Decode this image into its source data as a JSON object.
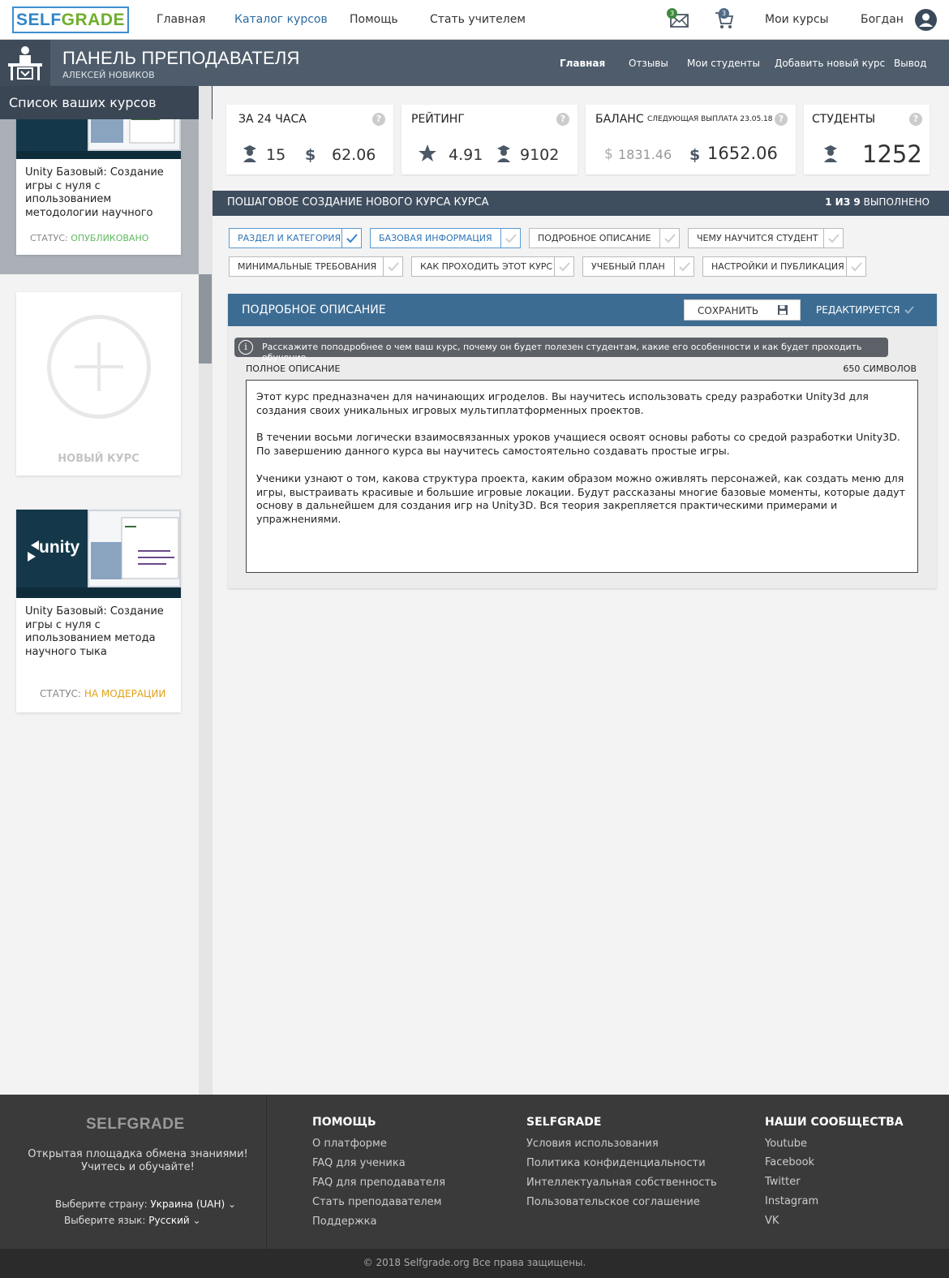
{
  "brand": {
    "part1": "SELF",
    "part2": "GRADE"
  },
  "nav": {
    "items": [
      "Главная",
      "Каталог курсов",
      "Помощь",
      "Стать учителем"
    ],
    "messages_count": "3",
    "cart_count": "3",
    "my_courses": "Мои курсы",
    "user_name": "Богдан"
  },
  "panel": {
    "title": "ПАНЕЛЬ ПРЕПОДАВАТЕЛЯ",
    "teacher_name": "АЛЕКСЕЙ НОВИКОВ",
    "links": [
      "Главная",
      "Отзывы",
      "Мои студенты",
      "Добавить новый курс",
      "Вывод"
    ]
  },
  "sidebar": {
    "title": "Список ваших курсов",
    "courses": [
      {
        "title": "Unity Базовый: Создание игры с нуля с ипользованием методологии научного",
        "status_label": "СТАТУС:",
        "status_value": "ОПУБЛИКОВАНО"
      },
      {
        "title": "Unity Базовый: Создание игры с нуля с ипользованием метода научного тыка",
        "status_label": "СТАТУС:",
        "status_value": "НА МОДЕРАЦИИ"
      }
    ],
    "new_course": "НОВЫЙ КУРС",
    "unity_logo_text": "unity"
  },
  "stats": {
    "day": {
      "title": "ЗА 24 ЧАСА",
      "students": "15",
      "earnings": "62.06"
    },
    "rating": {
      "title": "РЕЙТИНГ",
      "rating": "4.91",
      "reviews": "9102"
    },
    "balance": {
      "title": "БАЛАНС",
      "next_payout": "СЛЕДУЮЩАЯ ВЫПЛАТА 23.05.18",
      "pending": "1831.46",
      "available": "1652.06"
    },
    "students": {
      "title": "СТУДЕНТЫ",
      "count": "1252"
    },
    "help_glyph": "?",
    "dollar_glyph": "$"
  },
  "wizard": {
    "title": "ПОШАГОВОЕ СОЗДАНИЕ НОВОГО КУРСА КУРСА",
    "progress_bold": "1 ИЗ 9",
    "progress_rest": "ВЫПОЛНЕНО",
    "steps": [
      {
        "label": "РАЗДЕЛ И КАТЕГОРИЯ",
        "done": true
      },
      {
        "label": "БАЗОВАЯ ИНФОРМАЦИЯ",
        "done": true
      },
      {
        "label": "ПОДРОБНОЕ ОПИСАНИЕ",
        "done": false
      },
      {
        "label": "ЧЕМУ НАУЧИТСЯ СТУДЕНТ",
        "done": false
      },
      {
        "label": "МИНИМАЛЬНЫЕ ТРЕБОВАНИЯ",
        "done": false
      },
      {
        "label": "КАК ПРОХОДИТЬ ЭТОТ КУРС",
        "done": false
      },
      {
        "label": "УЧЕБНЫЙ ПЛАН",
        "done": false
      },
      {
        "label": "НАСТРОЙКИ И ПУБЛИКАЦИЯ",
        "done": false
      }
    ]
  },
  "editor": {
    "title": "ПОДРОБНОЕ ОПИСАНИЕ",
    "save": "СОХРАНИТЬ",
    "state": "РЕДАКТИРУЕТСЯ",
    "hint": "Расскажите поподробнее о чем ваш курс, почему он будет полезен студентам, какие его особенности и как будет проходить обучение.",
    "hint_glyph": "i",
    "field_label": "ПОЛНОЕ ОПИСАНИЕ",
    "char_count": "650 СИМВОЛОВ",
    "paragraphs": [
      "Этот курс предназначен для начинающих игроделов. Вы научитесь использовать среду разработки Unity3d для создания своих уникальных игровых мультиплатформенных проектов.",
      "В течении восьми логически взаимосвязанных уроков учащиеся освоят основы работы со средой разработки Unity3D. По завершению данного курса вы научитесь самостоятельно создавать простые игры.",
      "Ученики узнают о том, какова структура проекта, каким образом можно оживлять персонажей, как создать меню для игры, выстраивать красивые и большие игровые локации. Будут рассказаны многие базовые моменты, которые дадут основу в дальнейшем для создания игр на Unity3D. Вся теория закрепляется практическими примерами и упражнениями."
    ]
  },
  "footer": {
    "logo": "SELFGRADE",
    "tagline_1": "Открытая площадка обмена знаниями!",
    "tagline_2": "Учитесь и обучайте!",
    "country_label": "Выберите страну:",
    "country_value": "Украина (UAH)",
    "language_label": "Выберите язык:",
    "language_value": "Русский",
    "help": {
      "title": "ПОМОЩЬ",
      "links": [
        "О платформе",
        "FAQ для ученика",
        "FAQ для преподавателя",
        "Стать преподавателем",
        "Поддержка"
      ]
    },
    "selfgrade": {
      "title": "SELFGRADE",
      "links": [
        "Условия использования",
        "Политика конфиденциальности",
        "Интеллектуальная собственность",
        "Пользовательское соглашение"
      ]
    },
    "communities": {
      "title": "НАШИ СООБЩЕСТВА",
      "links": [
        "Youtube",
        "Facebook",
        "Twitter",
        "Instagram",
        "VK"
      ]
    },
    "copyright": "© 2018 Selfgrade.org Все права защищены."
  },
  "colors": {
    "brand_blue": "#2f86c8",
    "brand_green": "#6fae2d",
    "panel_dark": "#3f4e5f",
    "editor_blue": "#3d6c93",
    "status_published": "#5fb85f",
    "status_moderation": "#e0a21a"
  }
}
